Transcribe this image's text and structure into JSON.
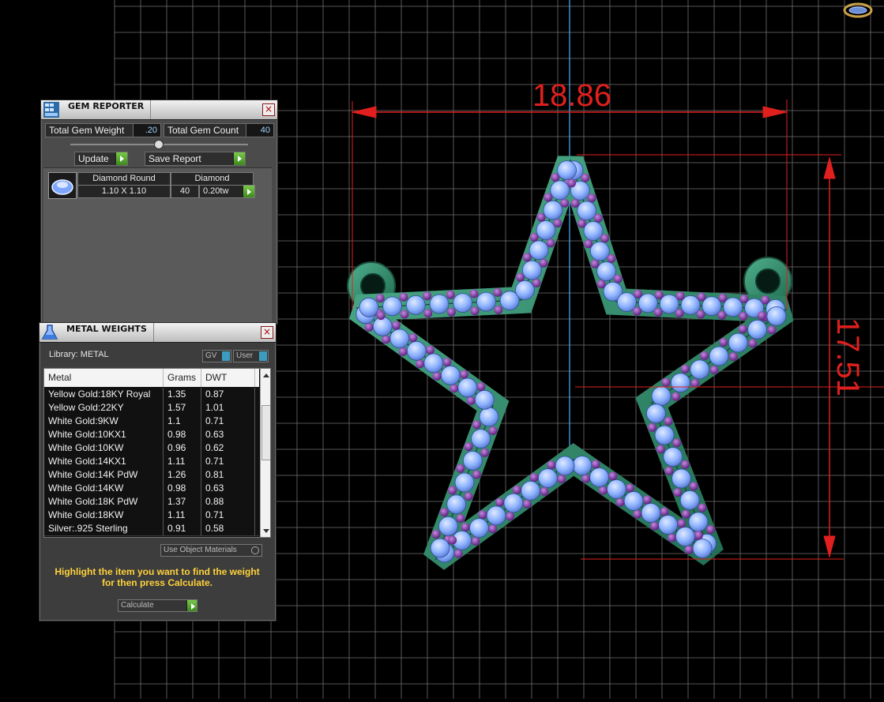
{
  "dimensions": {
    "width_label": "18.86",
    "height_label": "17.51"
  },
  "colors": {
    "dimension": "#e0201e",
    "axis": "#4fb0ff",
    "grid": "#8a8a8a",
    "metal": "#2f8a6a",
    "gem": "#8fb4ff",
    "accent_gem": "#7a2aa0",
    "hint": "#ffd23a"
  },
  "icons": {
    "top_right": "ring-logo-icon",
    "gem_panel": "gem-grid-icon",
    "metal_panel": "flask-icon",
    "gem_thumb": "round-gem-icon"
  },
  "gem_reporter": {
    "title": "GEM REPORTER",
    "close": "×",
    "total_weight_label": "Total Gem Weight",
    "total_weight_value": ".20",
    "total_count_label": "Total Gem Count",
    "total_count_value": "40",
    "update_label": "Update",
    "save_label": "Save Report",
    "gem": {
      "shape": "Diamond Round",
      "material": "Diamond",
      "size": "1.10 X 1.10",
      "count": "40",
      "weight": "0.20tw"
    }
  },
  "metal_weights": {
    "title": "METAL WEIGHTS",
    "close": "×",
    "library_label": "Library: METAL",
    "gv_label": "GV",
    "user_label": "User",
    "columns": [
      "Metal",
      "Grams",
      "DWT"
    ],
    "rows": [
      {
        "metal": "Yellow Gold:18KY Royal",
        "grams": "1.35",
        "dwt": "0.87"
      },
      {
        "metal": "Yellow Gold:22KY",
        "grams": "1.57",
        "dwt": "1.01"
      },
      {
        "metal": "White Gold:9KW",
        "grams": "1.1",
        "dwt": "0.71"
      },
      {
        "metal": "White Gold:10KX1",
        "grams": "0.98",
        "dwt": "0.63"
      },
      {
        "metal": "White Gold:10KW",
        "grams": "0.96",
        "dwt": "0.62"
      },
      {
        "metal": "White Gold:14KX1",
        "grams": "1.11",
        "dwt": "0.71"
      },
      {
        "metal": "White Gold:14K PdW",
        "grams": "1.26",
        "dwt": "0.81"
      },
      {
        "metal": "White Gold:14KW",
        "grams": "0.98",
        "dwt": "0.63"
      },
      {
        "metal": "White Gold:18K PdW",
        "grams": "1.37",
        "dwt": "0.88"
      },
      {
        "metal": "White Gold:18KW",
        "grams": "1.11",
        "dwt": "0.71"
      },
      {
        "metal": "Silver:.925 Sterling",
        "grams": "0.91",
        "dwt": "0.58"
      }
    ],
    "use_object_label": "Use Object Materials",
    "hint": "Highlight the item you want to find the weight for then press Calculate.",
    "calculate_label": "Calculate"
  }
}
